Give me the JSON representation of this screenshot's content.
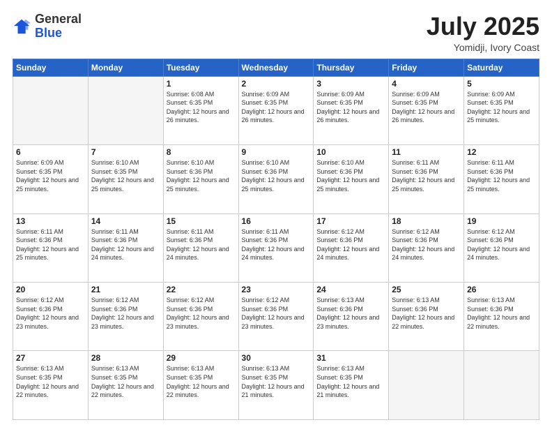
{
  "logo": {
    "general": "General",
    "blue": "Blue"
  },
  "title": "July 2025",
  "location": "Yomidji, Ivory Coast",
  "weekdays": [
    "Sunday",
    "Monday",
    "Tuesday",
    "Wednesday",
    "Thursday",
    "Friday",
    "Saturday"
  ],
  "weeks": [
    [
      {
        "day": "",
        "info": ""
      },
      {
        "day": "",
        "info": ""
      },
      {
        "day": "1",
        "info": "Sunrise: 6:08 AM\nSunset: 6:35 PM\nDaylight: 12 hours and 26 minutes."
      },
      {
        "day": "2",
        "info": "Sunrise: 6:09 AM\nSunset: 6:35 PM\nDaylight: 12 hours and 26 minutes."
      },
      {
        "day": "3",
        "info": "Sunrise: 6:09 AM\nSunset: 6:35 PM\nDaylight: 12 hours and 26 minutes."
      },
      {
        "day": "4",
        "info": "Sunrise: 6:09 AM\nSunset: 6:35 PM\nDaylight: 12 hours and 26 minutes."
      },
      {
        "day": "5",
        "info": "Sunrise: 6:09 AM\nSunset: 6:35 PM\nDaylight: 12 hours and 25 minutes."
      }
    ],
    [
      {
        "day": "6",
        "info": "Sunrise: 6:09 AM\nSunset: 6:35 PM\nDaylight: 12 hours and 25 minutes."
      },
      {
        "day": "7",
        "info": "Sunrise: 6:10 AM\nSunset: 6:35 PM\nDaylight: 12 hours and 25 minutes."
      },
      {
        "day": "8",
        "info": "Sunrise: 6:10 AM\nSunset: 6:36 PM\nDaylight: 12 hours and 25 minutes."
      },
      {
        "day": "9",
        "info": "Sunrise: 6:10 AM\nSunset: 6:36 PM\nDaylight: 12 hours and 25 minutes."
      },
      {
        "day": "10",
        "info": "Sunrise: 6:10 AM\nSunset: 6:36 PM\nDaylight: 12 hours and 25 minutes."
      },
      {
        "day": "11",
        "info": "Sunrise: 6:11 AM\nSunset: 6:36 PM\nDaylight: 12 hours and 25 minutes."
      },
      {
        "day": "12",
        "info": "Sunrise: 6:11 AM\nSunset: 6:36 PM\nDaylight: 12 hours and 25 minutes."
      }
    ],
    [
      {
        "day": "13",
        "info": "Sunrise: 6:11 AM\nSunset: 6:36 PM\nDaylight: 12 hours and 25 minutes."
      },
      {
        "day": "14",
        "info": "Sunrise: 6:11 AM\nSunset: 6:36 PM\nDaylight: 12 hours and 24 minutes."
      },
      {
        "day": "15",
        "info": "Sunrise: 6:11 AM\nSunset: 6:36 PM\nDaylight: 12 hours and 24 minutes."
      },
      {
        "day": "16",
        "info": "Sunrise: 6:11 AM\nSunset: 6:36 PM\nDaylight: 12 hours and 24 minutes."
      },
      {
        "day": "17",
        "info": "Sunrise: 6:12 AM\nSunset: 6:36 PM\nDaylight: 12 hours and 24 minutes."
      },
      {
        "day": "18",
        "info": "Sunrise: 6:12 AM\nSunset: 6:36 PM\nDaylight: 12 hours and 24 minutes."
      },
      {
        "day": "19",
        "info": "Sunrise: 6:12 AM\nSunset: 6:36 PM\nDaylight: 12 hours and 24 minutes."
      }
    ],
    [
      {
        "day": "20",
        "info": "Sunrise: 6:12 AM\nSunset: 6:36 PM\nDaylight: 12 hours and 23 minutes."
      },
      {
        "day": "21",
        "info": "Sunrise: 6:12 AM\nSunset: 6:36 PM\nDaylight: 12 hours and 23 minutes."
      },
      {
        "day": "22",
        "info": "Sunrise: 6:12 AM\nSunset: 6:36 PM\nDaylight: 12 hours and 23 minutes."
      },
      {
        "day": "23",
        "info": "Sunrise: 6:12 AM\nSunset: 6:36 PM\nDaylight: 12 hours and 23 minutes."
      },
      {
        "day": "24",
        "info": "Sunrise: 6:13 AM\nSunset: 6:36 PM\nDaylight: 12 hours and 23 minutes."
      },
      {
        "day": "25",
        "info": "Sunrise: 6:13 AM\nSunset: 6:36 PM\nDaylight: 12 hours and 22 minutes."
      },
      {
        "day": "26",
        "info": "Sunrise: 6:13 AM\nSunset: 6:36 PM\nDaylight: 12 hours and 22 minutes."
      }
    ],
    [
      {
        "day": "27",
        "info": "Sunrise: 6:13 AM\nSunset: 6:35 PM\nDaylight: 12 hours and 22 minutes."
      },
      {
        "day": "28",
        "info": "Sunrise: 6:13 AM\nSunset: 6:35 PM\nDaylight: 12 hours and 22 minutes."
      },
      {
        "day": "29",
        "info": "Sunrise: 6:13 AM\nSunset: 6:35 PM\nDaylight: 12 hours and 22 minutes."
      },
      {
        "day": "30",
        "info": "Sunrise: 6:13 AM\nSunset: 6:35 PM\nDaylight: 12 hours and 21 minutes."
      },
      {
        "day": "31",
        "info": "Sunrise: 6:13 AM\nSunset: 6:35 PM\nDaylight: 12 hours and 21 minutes."
      },
      {
        "day": "",
        "info": ""
      },
      {
        "day": "",
        "info": ""
      }
    ]
  ]
}
